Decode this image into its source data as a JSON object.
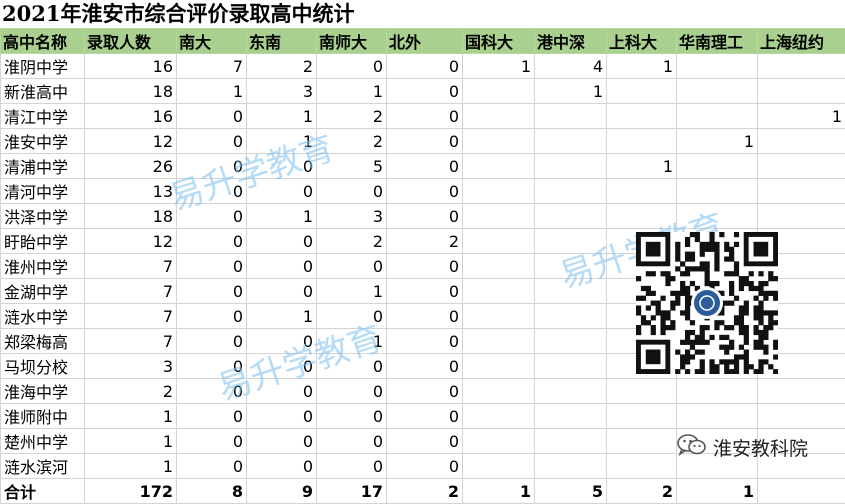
{
  "title": "2021年淮安市综合评价录取高中统计",
  "headers": [
    "高中名称",
    "录取人数",
    "南大",
    "东南",
    "南师大",
    "北外",
    "国科大",
    "港中深",
    "上科大",
    "华南理工",
    "上海纽约"
  ],
  "rows": [
    [
      "淮阴中学",
      "16",
      "7",
      "2",
      "0",
      "0",
      "1",
      "4",
      "1",
      "",
      ""
    ],
    [
      "新淮高中",
      "18",
      "1",
      "3",
      "1",
      "0",
      "",
      "1",
      "",
      "",
      ""
    ],
    [
      "清江中学",
      "16",
      "0",
      "1",
      "2",
      "0",
      "",
      "",
      "",
      "",
      "1"
    ],
    [
      "淮安中学",
      "12",
      "0",
      "1",
      "2",
      "0",
      "",
      "",
      "",
      "1",
      ""
    ],
    [
      "清浦中学",
      "26",
      "0",
      "0",
      "5",
      "0",
      "",
      "",
      "1",
      "",
      ""
    ],
    [
      "清河中学",
      "13",
      "0",
      "0",
      "0",
      "0",
      "",
      "",
      "",
      "",
      ""
    ],
    [
      "洪泽中学",
      "18",
      "0",
      "1",
      "3",
      "0",
      "",
      "",
      "",
      "",
      ""
    ],
    [
      "盱眙中学",
      "12",
      "0",
      "0",
      "2",
      "2",
      "",
      "",
      "",
      "",
      ""
    ],
    [
      "淮州中学",
      "7",
      "0",
      "0",
      "0",
      "0",
      "",
      "",
      "",
      "",
      ""
    ],
    [
      "金湖中学",
      "7",
      "0",
      "0",
      "1",
      "0",
      "",
      "",
      "",
      "",
      ""
    ],
    [
      "涟水中学",
      "7",
      "0",
      "1",
      "0",
      "0",
      "",
      "",
      "",
      "",
      ""
    ],
    [
      "郑梁梅高",
      "7",
      "0",
      "0",
      "1",
      "0",
      "",
      "",
      "",
      "",
      ""
    ],
    [
      "马坝分校",
      "3",
      "0",
      "0",
      "0",
      "0",
      "",
      "",
      "",
      "",
      ""
    ],
    [
      "淮海中学",
      "2",
      "0",
      "0",
      "0",
      "0",
      "",
      "",
      "",
      "",
      ""
    ],
    [
      "淮师附中",
      "1",
      "0",
      "0",
      "0",
      "0",
      "",
      "",
      "",
      "",
      ""
    ],
    [
      "楚州中学",
      "1",
      "0",
      "0",
      "0",
      "0",
      "",
      "",
      "",
      "",
      ""
    ],
    [
      "涟水滨河",
      "1",
      "0",
      "0",
      "0",
      "0",
      "",
      "",
      "",
      "",
      ""
    ]
  ],
  "total": [
    "合计",
    "172",
    "8",
    "9",
    "17",
    "2",
    "1",
    "5",
    "2",
    "1",
    ""
  ],
  "watermark": "易升学教育",
  "brand": {
    "name": "淮安教科院",
    "icon": "wechat-icon"
  },
  "qr_icon": "qr-code-icon",
  "colors": {
    "header_bg": "#a9d08e",
    "watermark": "#78bef0"
  }
}
